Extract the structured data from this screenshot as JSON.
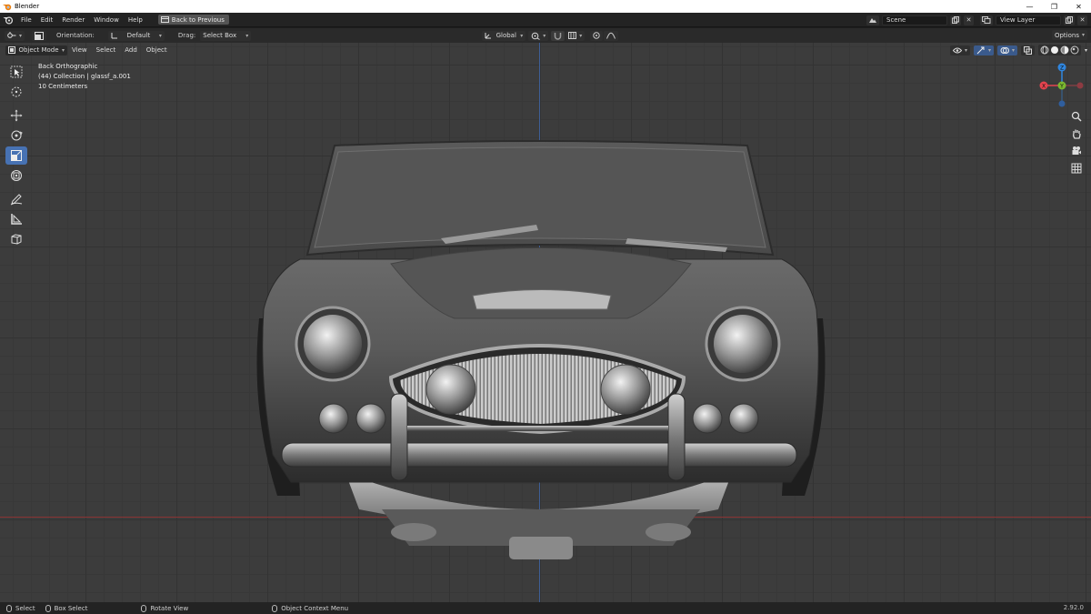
{
  "window": {
    "title": "Blender",
    "controls": [
      "—",
      "❐",
      "✕"
    ]
  },
  "menubar": {
    "items": [
      "File",
      "Edit",
      "Render",
      "Window",
      "Help"
    ],
    "back_label": "Back to Previous",
    "scene_value": "Scene",
    "view_layer_value": "View Layer"
  },
  "toolheader": {
    "orientation_label": "Orientation:",
    "orientation_value": "Default",
    "drag_label": "Drag:",
    "drag_value": "Select Box",
    "transform_value": "Global",
    "options_label": "Options"
  },
  "viewport_header": {
    "mode_value": "Object Mode",
    "items": [
      "View",
      "Select",
      "Add",
      "Object"
    ]
  },
  "overlay": {
    "view_name": "Back Orthographic",
    "collection": "(44) Collection | glassf_a.001",
    "scale": "10 Centimeters"
  },
  "gizmo": {
    "z": "Z",
    "y": "Y",
    "x": "X"
  },
  "statusbar": {
    "select": "Select",
    "box_select": "Box Select",
    "rotate": "Rotate View",
    "context_menu": "Object Context Menu",
    "version": "2.92.0"
  },
  "colors": {
    "accent": "#4772b3",
    "x_axis": "#e5434e",
    "y_axis": "#7ab82f",
    "z_axis": "#2f86e0"
  }
}
